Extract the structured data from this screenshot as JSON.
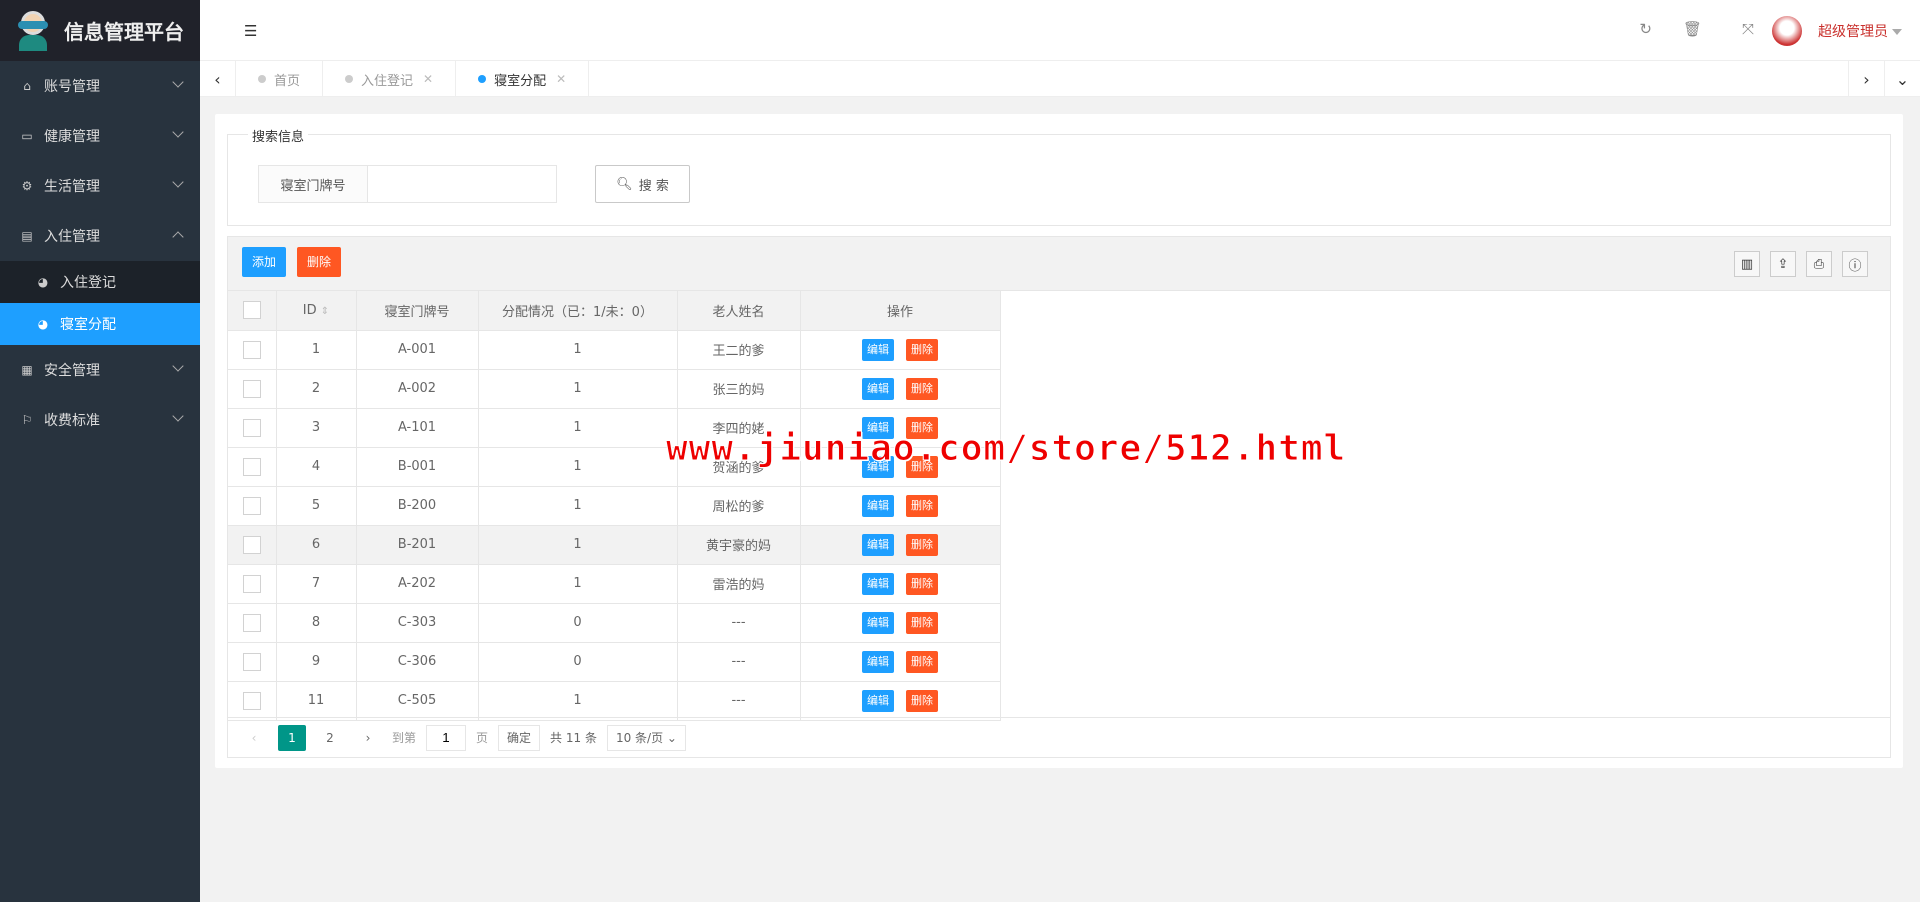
{
  "app": {
    "title": "信息管理平台"
  },
  "sidebar": {
    "items": [
      {
        "label": "账号管理",
        "icon": "home-icon"
      },
      {
        "label": "健康管理",
        "icon": "window-icon"
      },
      {
        "label": "生活管理",
        "icon": "cogs-icon"
      },
      {
        "label": "入住管理",
        "icon": "file-icon",
        "expanded": true,
        "children": [
          {
            "label": "入住登记"
          },
          {
            "label": "寝室分配",
            "active": true
          }
        ]
      },
      {
        "label": "安全管理",
        "icon": "calendar-icon"
      },
      {
        "label": "收费标准",
        "icon": "flag-icon"
      }
    ]
  },
  "header": {
    "user": "超级管理员"
  },
  "tabs": [
    {
      "label": "首页"
    },
    {
      "label": "入住登记"
    },
    {
      "label": "寝室分配",
      "active": true
    }
  ],
  "search": {
    "legend": "搜索信息",
    "field_label": "寝室门牌号",
    "value": "",
    "button": "搜 索"
  },
  "toolbar": {
    "add": "添加",
    "delete": "删除"
  },
  "table": {
    "headers": [
      "ID",
      "寝室门牌号",
      "分配情况（已：1/未：0）",
      "老人姓名",
      "操作"
    ],
    "edit_label": "编辑",
    "delete_label": "删除",
    "rows": [
      {
        "id": "1",
        "room": "A-001",
        "status": "1",
        "name": "王二的爹"
      },
      {
        "id": "2",
        "room": "A-002",
        "status": "1",
        "name": "张三的妈"
      },
      {
        "id": "3",
        "room": "A-101",
        "status": "1",
        "name": "李四的姥"
      },
      {
        "id": "4",
        "room": "B-001",
        "status": "1",
        "name": "贺涵的爹"
      },
      {
        "id": "5",
        "room": "B-200",
        "status": "1",
        "name": "周松的爹"
      },
      {
        "id": "6",
        "room": "B-201",
        "status": "1",
        "name": "黄宇豪的妈"
      },
      {
        "id": "7",
        "room": "A-202",
        "status": "1",
        "name": "雷浩的妈"
      },
      {
        "id": "8",
        "room": "C-303",
        "status": "0",
        "name": "---"
      },
      {
        "id": "9",
        "room": "C-306",
        "status": "0",
        "name": "---"
      },
      {
        "id": "11",
        "room": "C-505",
        "status": "1",
        "name": "---"
      }
    ]
  },
  "pagination": {
    "pages": [
      "1",
      "2"
    ],
    "current": "1",
    "goto_label": "到第",
    "goto_value": "1",
    "page_suffix": "页",
    "confirm": "确定",
    "total": "共 11 条",
    "page_size": "10 条/页"
  },
  "watermark": "www.jiuniao.com/store/512.html"
}
